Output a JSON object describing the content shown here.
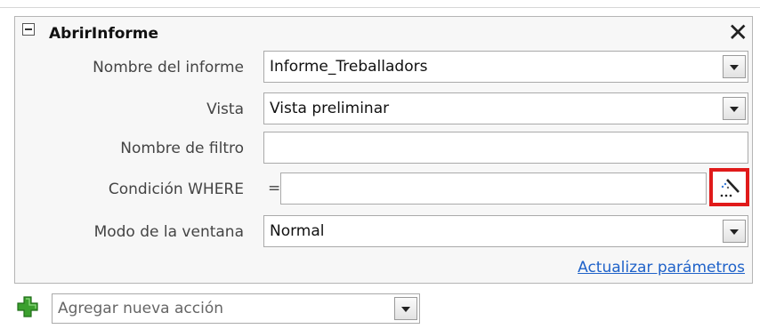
{
  "action": {
    "name": "AbrirInforme",
    "close_glyph": "✕"
  },
  "fields": {
    "report_name": {
      "label": "Nombre del informe",
      "value": "Informe_Treballadors"
    },
    "view": {
      "label": "Vista",
      "value": "Vista preliminar"
    },
    "filter_name": {
      "label": "Nombre de filtro",
      "value": ""
    },
    "where_condition": {
      "label": "Condición WHERE",
      "prefix": "=",
      "value": ""
    },
    "window_mode": {
      "label": "Modo de la ventana",
      "value": "Normal"
    }
  },
  "update_link": "Actualizar parámetros",
  "add_action": {
    "placeholder": "Agregar nueva acción"
  },
  "colors": {
    "highlight": "#e01a1a",
    "link": "#1f62c9",
    "add_icon": "#3ba02e"
  }
}
